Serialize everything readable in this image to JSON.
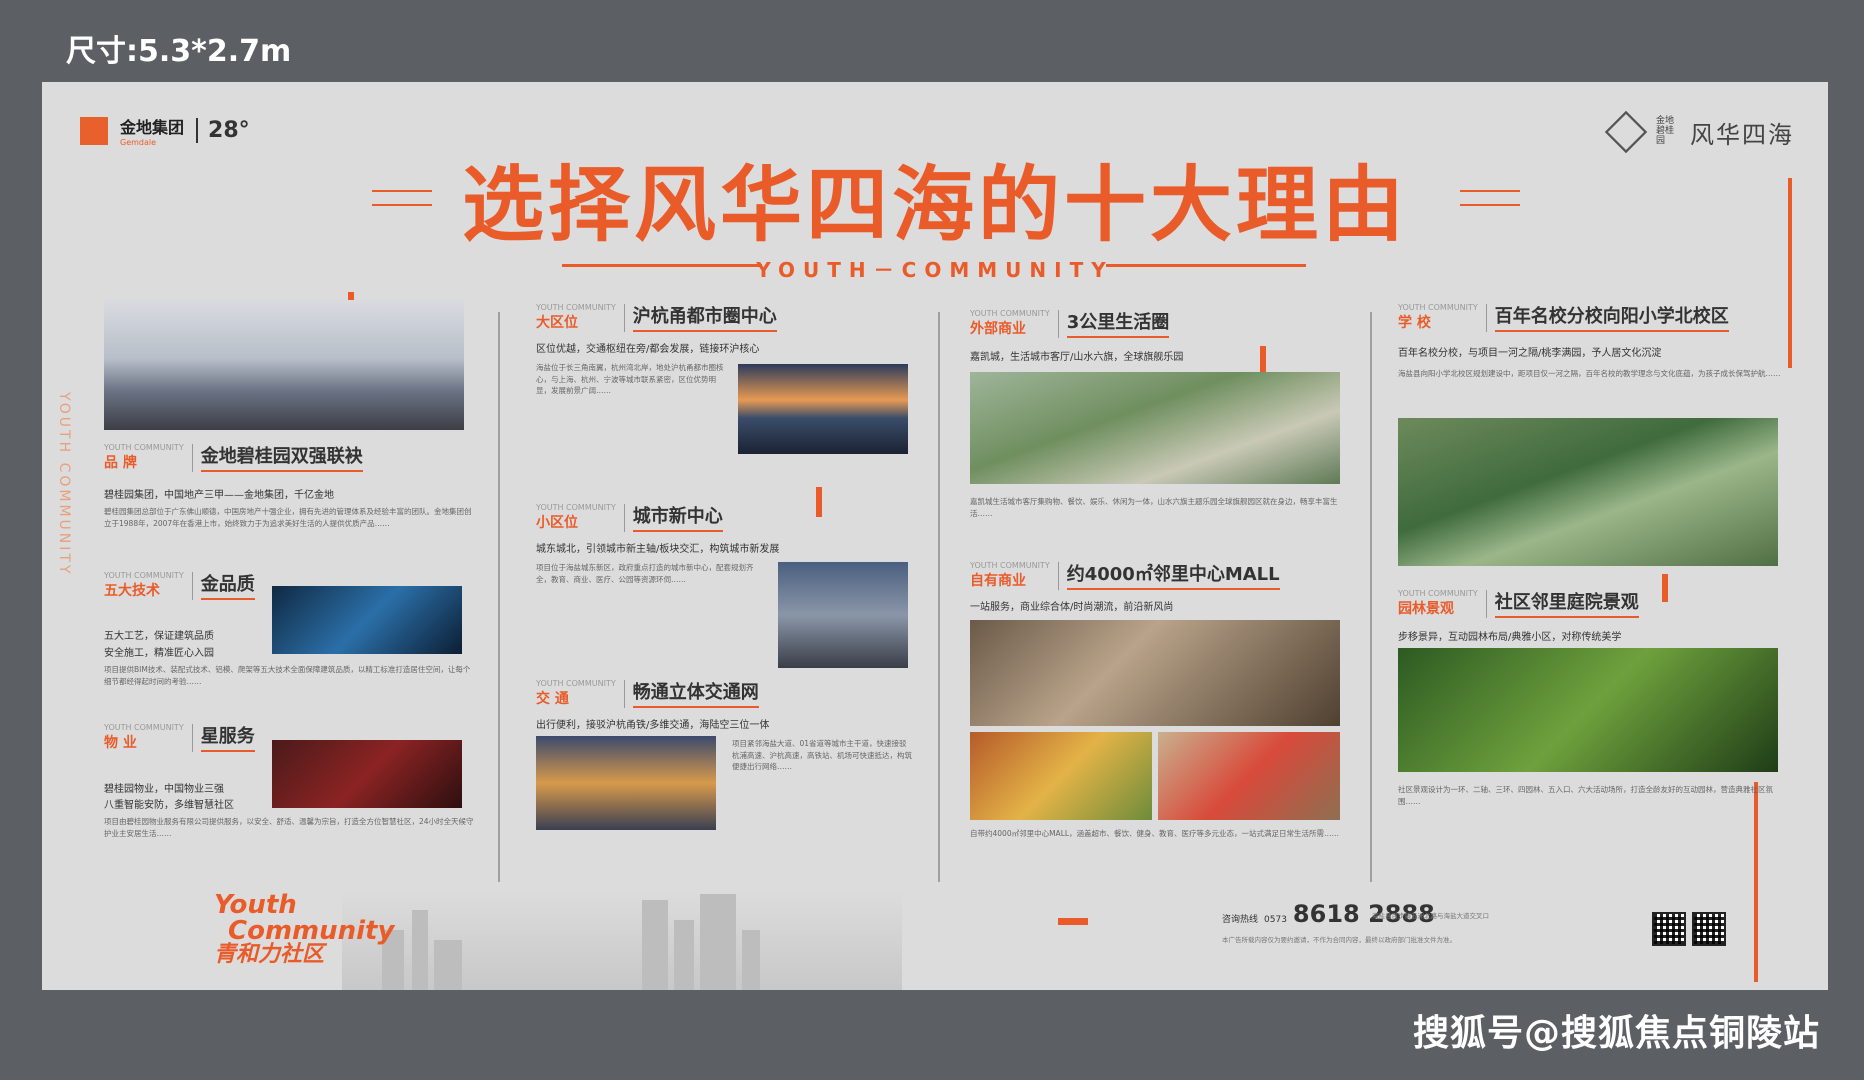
{
  "size_label": "尺寸:5.3*2.7m",
  "watermark": "搜狐号@搜狐焦点铜陵站",
  "logo": {
    "group": "金地集团",
    "gemdale": "Gemdale",
    "degree": "28°",
    "right_name": "风华四海",
    "right_brand": "金地 碧桂园"
  },
  "title": "选择风华四海的十大理由",
  "subtitle": "YOUTH－COMMUNITY",
  "vertical_text": "YOUTH COMMUNITY",
  "small_tag": "YOUTH COMMUNITY",
  "sections": {
    "brand": {
      "category": "品 牌",
      "heading": "金地碧桂园双强联袂",
      "sub": "碧桂园集团，中国地产三甲——金地集团，千亿金地",
      "body": "碧桂园集团总部位于广东佛山顺德，中国房地产十强企业，拥有先进的管理体系及经验丰富的团队。金地集团创立于1988年，2007年在香港上市，始终致力于为追求美好生活的人提供优质产品……"
    },
    "tech": {
      "category": "五大技术",
      "heading": "金品质",
      "sub1": "五大工艺，保证建筑品质",
      "sub2": "安全施工，精准匠心入园",
      "body": "项目提供BIM技术、装配式技术、铝模、爬架等五大技术全面保障建筑品质，以精工标准打造居住空间，让每个细节都经得起时间的考验……"
    },
    "service": {
      "category": "物 业",
      "heading": "星服务",
      "sub1": "碧桂园物业，中国物业三强",
      "sub2": "八重智能安防，多维智慧社区",
      "body": "项目由碧桂园物业服务有限公司提供服务，以安全、舒适、温馨为宗旨，打造全方位智慧社区，24小时全天候守护业主安居生活……"
    },
    "location": {
      "category": "大区位",
      "heading": "沪杭甬都市圈中心",
      "sub": "区位优越，交通枢纽在旁/都会发展，链接环沪核心",
      "body": "海盐位于长三角南翼，杭州湾北岸，地处沪杭甬都市圈核心，与上海、杭州、宁波等城市联系紧密，区位优势明显，发展前景广阔……"
    },
    "district": {
      "category": "小区位",
      "heading": "城市新中心",
      "sub": "城东城北，引领城市新主轴/板块交汇，构筑城市新发展",
      "body": "项目位于海盐城东新区，政府重点打造的城市新中心，配套规划齐全，教育、商业、医疗、公园等资源环伺……"
    },
    "traffic": {
      "category": "交 通",
      "heading": "畅通立体交通网",
      "sub": "出行便利，接驳沪杭甬铁/多维交通，海陆空三位一体",
      "body": "项目紧邻海盐大道、01省道等城市主干道，快速接驳杭浦高速、沪杭高速，高铁站、机场可快速抵达，构筑便捷出行网络……"
    },
    "commerce_outer": {
      "category": "外部商业",
      "heading": "3公里生活圈",
      "sub": "嘉凯城，生活城市客厅/山水六旗，全球旗舰乐园",
      "body": "嘉凯城生活城市客厅集购物、餐饮、娱乐、休闲为一体，山水六旗主题乐园全球旗舰园区就在身边，畅享丰富生活……"
    },
    "commerce_own": {
      "category": "自有商业",
      "heading": "约4000㎡邻里中心MALL",
      "sub": "一站服务，商业综合体/时尚潮流，前沿新风尚",
      "body": "自带约4000㎡邻里中心MALL，涵盖超市、餐饮、健身、教育、医疗等多元业态，一站式满足日常生活所需……"
    },
    "school": {
      "category": "学 校",
      "heading": "百年名校分校向阳小学北校区",
      "sub": "百年名校分校，与项目一河之隔/桃李满园，予人居文化沉淀",
      "body": "海盐县向阳小学北校区规划建设中，距项目仅一河之隔，百年名校的教学理念与文化底蕴，为孩子成长保驾护航……"
    },
    "landscape": {
      "category": "园林景观",
      "heading": "社区邻里庭院景观",
      "sub": "步移景异，互动园林布局/典雅小区，对称传统美学",
      "body": "社区景观设计为一环、二轴、三环、四园林、五入口、六大活动场所，打造全龄友好的互动园林，营造典雅社区氛围……"
    }
  },
  "youth_sign": {
    "line1": "Youth",
    "line2": "Community",
    "cn": "青和力社区"
  },
  "contact": {
    "label": "咨询热线",
    "area": "0573",
    "phone": "8618 2888",
    "address": "海盐县百步镇五洲北路与海盐大道交叉口",
    "footer_note": "本广告所载内容仅为要约邀请，不作为合同内容，最终以政府部门批准文件为准。"
  },
  "colors": {
    "accent": "#ea5b2a",
    "board": "#dcdcdc",
    "frame": "#5c5f63"
  }
}
